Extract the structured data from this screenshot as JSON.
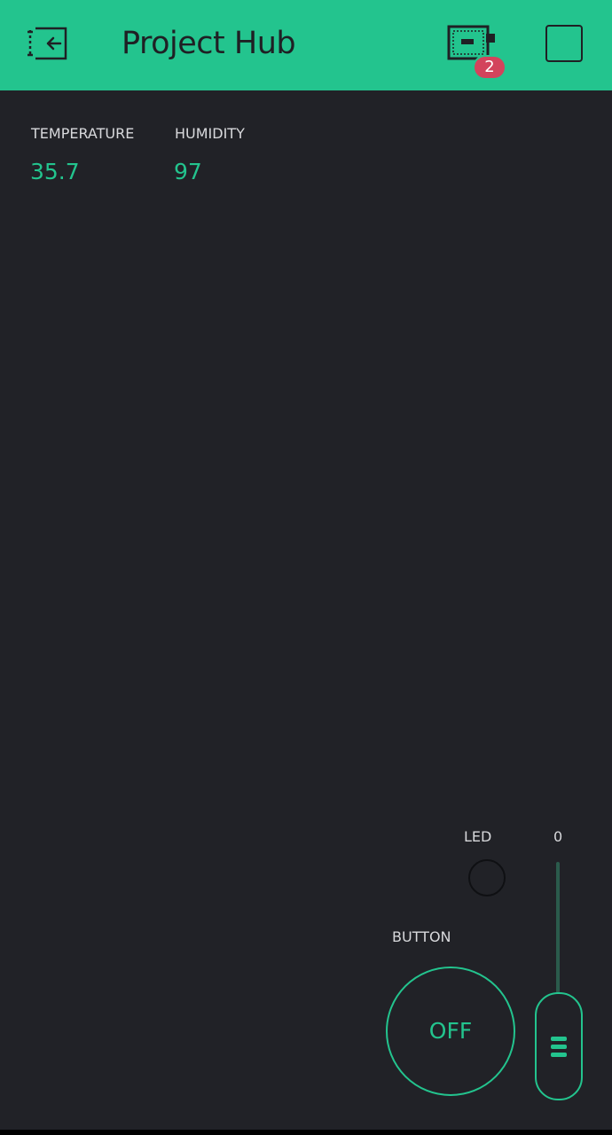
{
  "header": {
    "title": "Project Hub",
    "back_icon": "exit-icon",
    "device_icon": "device-board-icon",
    "device_badge_count": "2",
    "play_icon": "play-icon",
    "accent_color": "#23c48e",
    "badge_color": "#d3435c"
  },
  "widgets": {
    "temperature": {
      "label": "TEMPERATURE",
      "value": "35.7"
    },
    "humidity": {
      "label": "HUMIDITY",
      "value": "97"
    },
    "led": {
      "label": "LED"
    },
    "slider": {
      "value_label": "0",
      "value": 0
    },
    "button": {
      "label": "BUTTON",
      "state": "OFF"
    }
  },
  "colors": {
    "background": "#212227",
    "text_light": "#d8d9dc",
    "accent": "#23c48e"
  }
}
